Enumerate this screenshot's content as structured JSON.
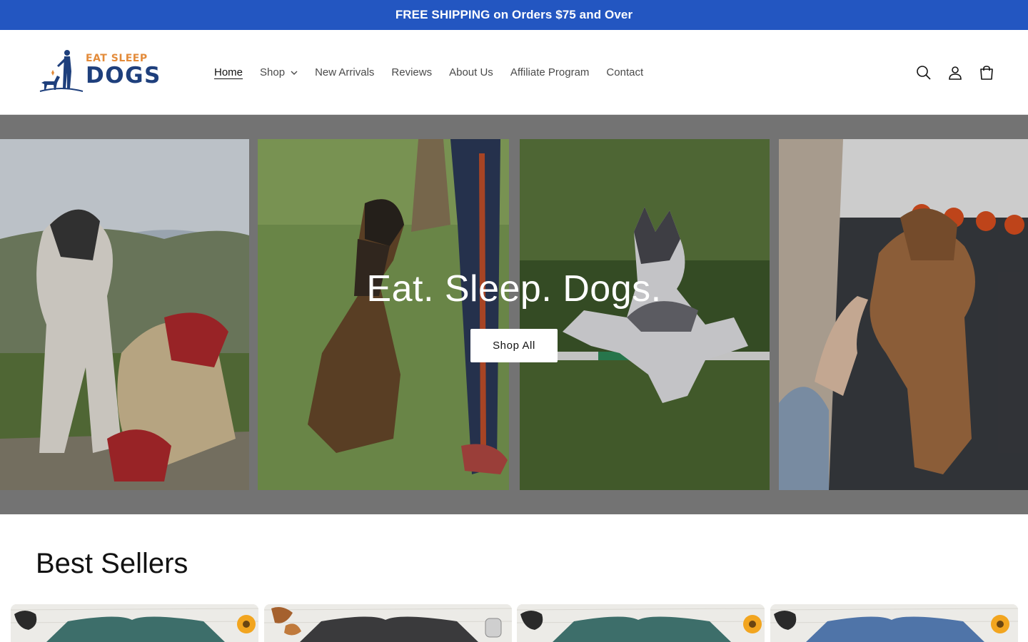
{
  "announcement": {
    "text": "FREE SHIPPING on Orders $75 and Over"
  },
  "brand": {
    "name_top": "EAT SLEEP",
    "name_main": "DOGS",
    "primary_color": "#1e3f7c",
    "accent_color": "#e38b3a"
  },
  "nav": {
    "items": [
      {
        "label": "Home",
        "active": true
      },
      {
        "label": "Shop",
        "dropdown": true
      },
      {
        "label": "New Arrivals"
      },
      {
        "label": "Reviews"
      },
      {
        "label": "About Us"
      },
      {
        "label": "Affiliate Program"
      },
      {
        "label": "Contact"
      }
    ]
  },
  "header_icons": [
    "search-icon",
    "account-icon",
    "cart-icon"
  ],
  "hero": {
    "title": "Eat. Sleep. Dogs.",
    "button_label": "Shop All"
  },
  "best_sellers": {
    "title": "Best Sellers",
    "products": [
      {
        "shirt_color": "#3d6e6a"
      },
      {
        "shirt_color": "#3a3a3c"
      },
      {
        "shirt_color": "#3d6e6a"
      },
      {
        "shirt_color": "#4f74a8"
      }
    ]
  },
  "colors": {
    "announcement_bg": "#2356c1",
    "hero_bg": "#8a8a8a"
  }
}
